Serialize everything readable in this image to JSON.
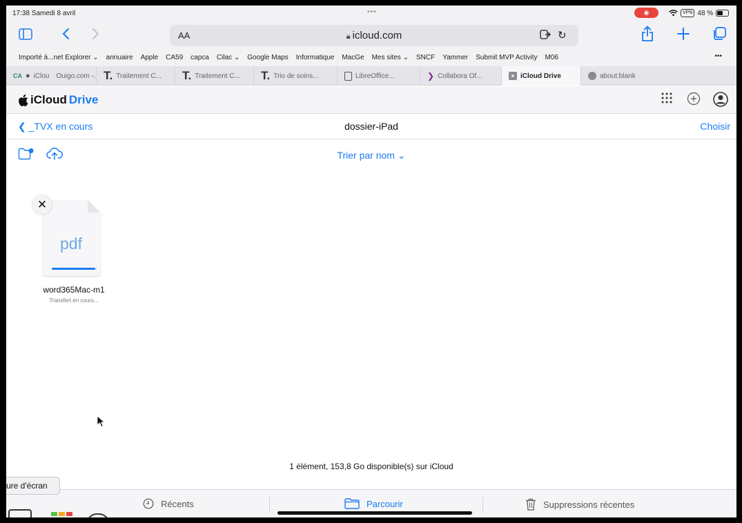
{
  "status_bar": {
    "time": "17:38  Samedi 8 avril",
    "dots": "•••",
    "vpn": "VPN",
    "battery": "48 %"
  },
  "toolbar": {
    "aa_label": "AA",
    "url": "icloud.com"
  },
  "bookmarks": [
    "Importé à...net Explorer ⌄",
    "annuaire",
    "Apple",
    "CA59",
    "capca",
    "Cilac ⌄",
    "Google Maps",
    "Informatique",
    "MacGe",
    "Mes sites ⌄",
    "SNCF",
    "Yammer",
    "Submit MVP Activity",
    "M06"
  ],
  "bookmarks_more": "•••",
  "tabs": [
    {
      "label": "iClou",
      "active": false
    },
    {
      "label": "Ouigo.com -...",
      "active": false
    },
    {
      "label": "Traitement C...",
      "active": false
    },
    {
      "label": "Traitement C...",
      "active": false
    },
    {
      "label": "Trio de soins...",
      "active": false
    },
    {
      "label": "LibreOffice...",
      "active": false
    },
    {
      "label": "Collabora Of...",
      "active": false
    },
    {
      "label": "iCloud Drive",
      "active": true
    },
    {
      "label": "about:blank",
      "active": false
    }
  ],
  "icloud": {
    "brand_prefix": "iCloud",
    "brand_suffix": "Drive",
    "back_label": "_TVX en cours",
    "folder_title": "dossier-iPad",
    "choose_label": "Choisir",
    "sort_label": "Trier par nom ⌄"
  },
  "file": {
    "type_label": "pdf",
    "name": "word365Mac-m1",
    "status": "Transfert en cours...",
    "upload_progress": 0.95
  },
  "footer_info": "1 élément, 153,8 Go disponible(s) sur iCloud",
  "tooltip": "ure d'écran",
  "tabbar": {
    "recents": "Récents",
    "browse": "Parcourir",
    "trash": "Suppressions récentes"
  },
  "colors": {
    "accent": "#1a7bf2",
    "record": "#e8453c"
  }
}
